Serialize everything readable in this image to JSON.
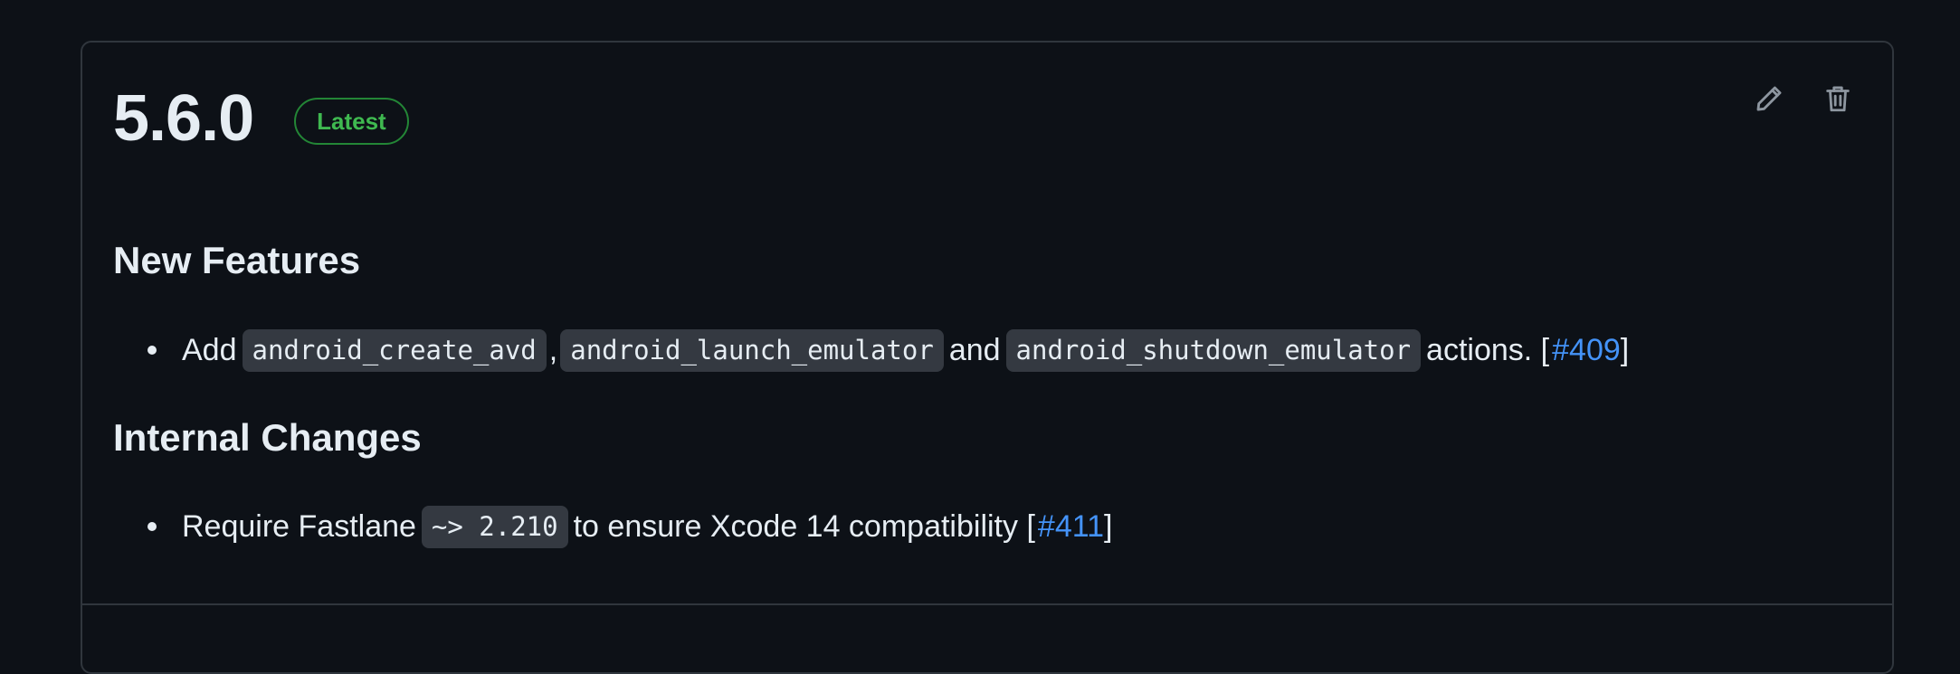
{
  "release": {
    "version": "5.6.0",
    "badge": "Latest",
    "icons": {
      "edit": "pencil-icon",
      "delete": "trash-icon"
    }
  },
  "sections": [
    {
      "heading": "New Features",
      "item": {
        "prefix": "Add",
        "code1": "android_create_avd",
        "sep1": ",",
        "code2": "android_launch_emulator",
        "and": "and",
        "code3": "android_shutdown_emulator",
        "suffix": "actions. [",
        "link": "#409",
        "close": "]"
      }
    },
    {
      "heading": "Internal Changes",
      "item": {
        "prefix": "Require Fastlane",
        "code1": "~> 2.210",
        "suffix": "to ensure Xcode 14 compatibility [",
        "link": "#411",
        "close": "]"
      }
    }
  ],
  "colors": {
    "background": "#0d1117",
    "border": "#30363d",
    "badge_green": "#3fb950",
    "link_blue": "#4493f8",
    "code_bg": "#343941"
  }
}
